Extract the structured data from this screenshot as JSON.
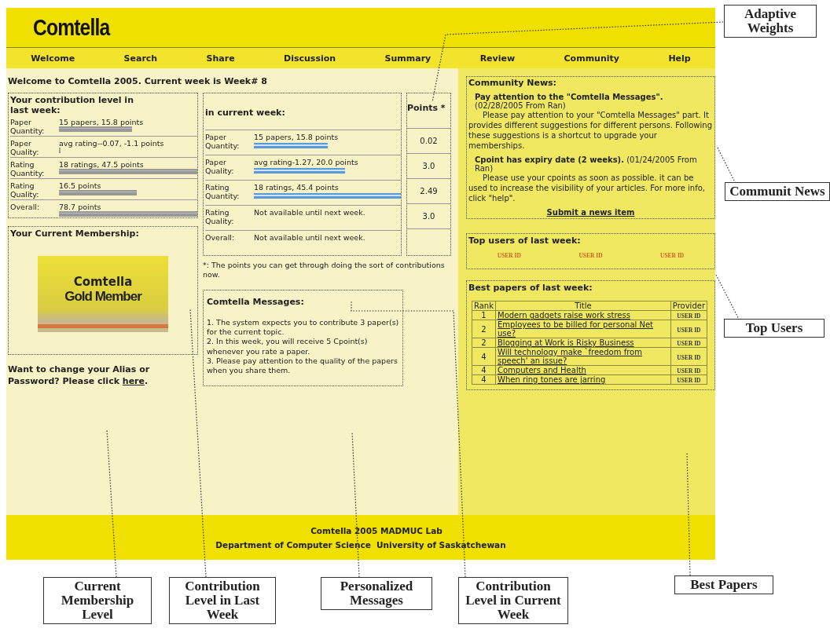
{
  "header": {
    "logo": "Comtella"
  },
  "nav": [
    "Welcome",
    "Search",
    "Share",
    "Discussion",
    "Summary",
    "Review",
    "Community",
    "Help"
  ],
  "welcome": "Welcome to Comtella 2005. Current week is Week# 8",
  "last_week": {
    "title": "Your contribution level in last week:",
    "rows": [
      {
        "label": "Paper Quantity:",
        "reading": "15 papers, 15.8 points"
      },
      {
        "label": "Paper Quality:",
        "reading": "avg rating--0.07, -1.1 points"
      },
      {
        "label": "Rating Quantity:",
        "reading": "18 ratings, 47.5 points"
      },
      {
        "label": "Rating Quality:",
        "reading": "16.5 points"
      },
      {
        "label": "Overall:",
        "reading": "78.7 points"
      }
    ]
  },
  "current_week": {
    "title": "in current week:",
    "rows": [
      {
        "label": "Paper Quantity:",
        "reading": "15 papers, 15.8 points"
      },
      {
        "label": "Paper Quality:",
        "reading": "avg rating-1.27, 20.0 points"
      },
      {
        "label": "Rating Quantity:",
        "reading": "18 ratings, 45.4 points"
      },
      {
        "label": "Rating Quality:",
        "reading": "Not available until next week."
      },
      {
        "label": "Overall:",
        "reading": "Not available until next week."
      }
    ]
  },
  "points": {
    "title": "Points *",
    "values": [
      "0.02",
      "3.0",
      "2.49",
      "3.0"
    ]
  },
  "footnote": "*: The points you can get through doing the sort of contributions now.",
  "membership": {
    "title": "Your Current Membership:",
    "badge_line_1": "Comtella",
    "badge_line_2": "Gold Member"
  },
  "alias_note": {
    "text": "Want to change your Alias or Password? Please click ",
    "link": "here",
    "end": "."
  },
  "messages": {
    "title": "Comtella Messages:",
    "items": [
      "1. The system expects you to contribute 3 paper(s) for the current topic.",
      "2. In this week, you will receive 5 Cpoint(s) whenever you rate a paper.",
      "3. Please pay attention to the quality of the papers when you share them."
    ]
  },
  "community_news": {
    "title": "Community News:",
    "items": [
      {
        "headline": "**Pay attention to the \"Comtella Messages\".** (02/28/2005 From Ran)",
        "body": "Please pay attention to your \"Comtella Messages\" part. It provides different suggestions for different persons. Following these suggestions is a shortcut to upgrade your memberships."
      },
      {
        "headline": "**Cpoint has expiry date (2 weeks).** (01/24/2005 From Ran)",
        "body": "Please use your cpoints as soon as possible. it can be used to increase the visibility of your articles. For more info, click \"help\"."
      }
    ],
    "submit_link": "Submit a news item"
  },
  "top_users": {
    "title": "Top users of last week:",
    "users": [
      "USER ID",
      "USER ID",
      "USER ID"
    ]
  },
  "best_papers": {
    "title": "Best papers of last week:",
    "columns": [
      "Rank",
      "Title",
      "Provider"
    ],
    "rows": [
      {
        "rank": "1",
        "title": "Modern gadgets raise work stress",
        "provider": "USER ID"
      },
      {
        "rank": "2",
        "title": "Employees to be billed for personal Net use?",
        "provider": "USER ID"
      },
      {
        "rank": "2",
        "title": "Blogging at Work is Risky Business",
        "provider": "USER ID"
      },
      {
        "rank": "4",
        "title": "Will technology make `freedom from speech' an issue?",
        "provider": "USER ID"
      },
      {
        "rank": "4",
        "title": "Computers and Health",
        "provider": "USER ID"
      },
      {
        "rank": "4",
        "title": "When ring tones are jarring",
        "provider": "USER ID"
      }
    ]
  },
  "footer": [
    "Comtella 2005 MADMUC Lab",
    "Department of Computer Science  University of Saskatchewan"
  ],
  "annotations": [
    "Adaptive Weights",
    "Communit News",
    "Top Users",
    "Current Membership Level",
    "Contribution Level in Last Week",
    "Personalized Messages",
    "Contribution Level in Current Week",
    "Best Papers"
  ]
}
